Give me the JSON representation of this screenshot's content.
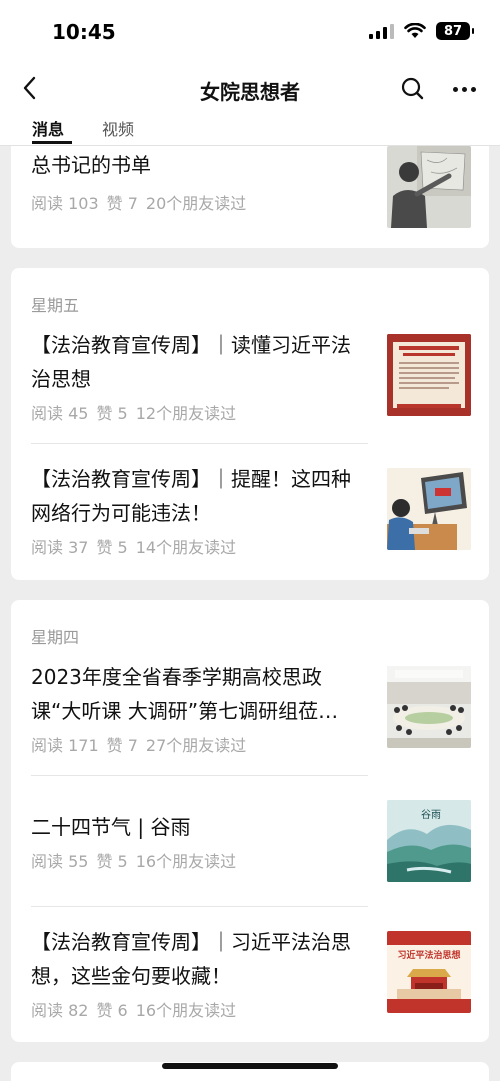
{
  "status": {
    "time": "10:45",
    "battery": "87"
  },
  "nav": {
    "title": "女院思想者"
  },
  "tabs": [
    {
      "label": "消息"
    },
    {
      "label": "视频"
    }
  ],
  "groups": [
    {
      "articles": [
        {
          "title": "总书记的书单",
          "reads": "阅读 103",
          "likes": "赞 7",
          "friends": "20个朋友读过",
          "thumb": "photo-man-pointing-map"
        }
      ]
    },
    {
      "day": "星期五",
      "articles": [
        {
          "title": "【法治教育宣传周】｜读懂习近平法治思想",
          "reads": "阅读 45",
          "likes": "赞 5",
          "friends": "12个朋友读过",
          "thumb": "red-poster"
        },
        {
          "title": "【法治教育宣传周】｜提醒！这四种网络行为可能违法！",
          "reads": "阅读 37",
          "likes": "赞 5",
          "friends": "14个朋友读过",
          "thumb": "cartoon-computer"
        }
      ]
    },
    {
      "day": "星期四",
      "articles": [
        {
          "title": "2023年度全省春季学期高校思政课“大听课 大调研”第七调研组莅…",
          "reads": "阅读 171",
          "likes": "赞 7",
          "friends": "27个朋友读过",
          "thumb": "photo-meeting-room"
        },
        {
          "title": "二十四节气 | 谷雨",
          "reads": "阅读 55",
          "likes": "赞 5",
          "friends": "16个朋友读过",
          "thumb": "landscape-painting",
          "thumb_text": "谷雨"
        },
        {
          "title": "【法治教育宣传周】｜习近平法治思想，这些金句要收藏！",
          "reads": "阅读 82",
          "likes": "赞 6",
          "friends": "16个朋友读过",
          "thumb": "red-banner-tiananmen",
          "thumb_text": "习近平法治思想"
        }
      ]
    }
  ],
  "colors": {
    "background": "#ededed",
    "card": "#ffffff",
    "meta": "#a8a8a8",
    "accent_red": "#c0342b"
  }
}
